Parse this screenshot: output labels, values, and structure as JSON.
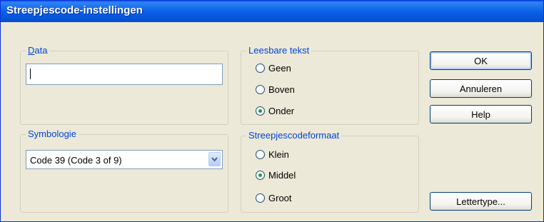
{
  "window": {
    "title": "Streepjescode-instellingen"
  },
  "data_group": {
    "label": "Data",
    "accesskey": "D",
    "value": ""
  },
  "symbology_group": {
    "label": "Symbologie",
    "selected": "Code 39 (Code 3 of 9)"
  },
  "readable_text_group": {
    "label": "Leesbare tekst",
    "options": [
      {
        "label": "Geen",
        "accesskey": "G",
        "selected": false
      },
      {
        "label": "Boven",
        "accesskey": "B",
        "selected": false
      },
      {
        "label": "Onder",
        "accesskey": "O",
        "selected": true
      }
    ]
  },
  "format_group": {
    "label": "Streepjescodeformaat",
    "options": [
      {
        "label": "Klein",
        "accesskey": "K",
        "selected": false
      },
      {
        "label": "Middel",
        "accesskey": "M",
        "selected": true
      },
      {
        "label": "Groot",
        "accesskey": "r",
        "selected": false
      }
    ]
  },
  "buttons": {
    "ok": "OK",
    "cancel": "Annuleren",
    "help": "Help",
    "font": "Lettertype..."
  }
}
